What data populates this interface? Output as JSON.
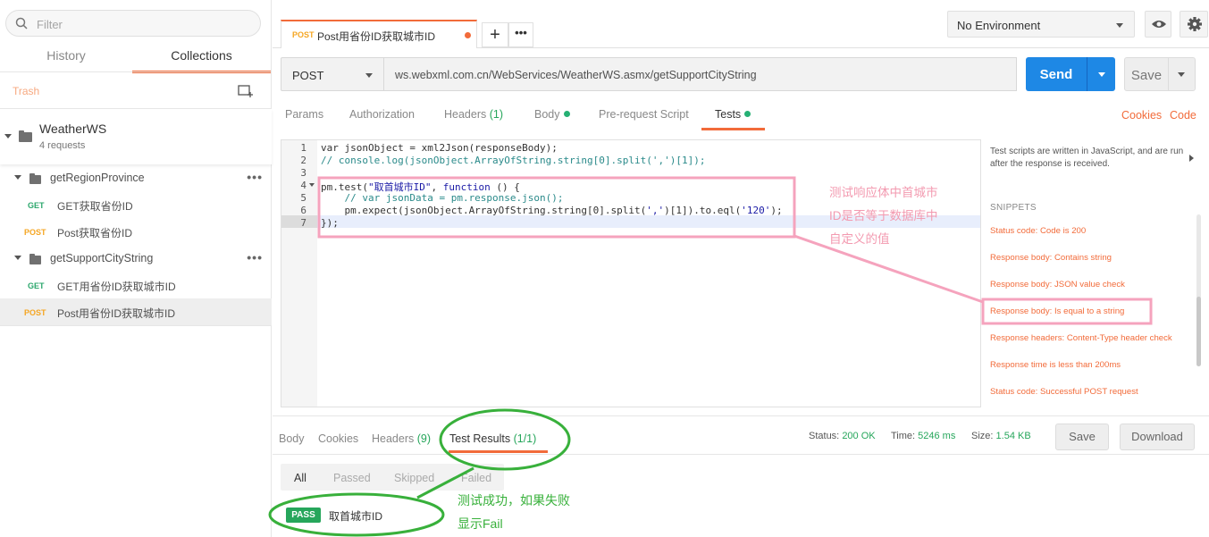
{
  "sidebar": {
    "filter_placeholder": "Filter",
    "tabs": [
      "History",
      "Collections"
    ],
    "trash_label": "Trash",
    "collection": {
      "name": "WeatherWS",
      "count": "4 requests"
    },
    "folders": [
      {
        "name": "getRegionProvince",
        "requests": [
          {
            "method": "GET",
            "name": "GET获取省份ID"
          },
          {
            "method": "POST",
            "name": "Post获取省份ID"
          }
        ]
      },
      {
        "name": "getSupportCityString",
        "requests": [
          {
            "method": "GET",
            "name": "GET用省份ID获取城市ID"
          },
          {
            "method": "POST",
            "name": "Post用省份ID获取城市ID"
          }
        ]
      }
    ]
  },
  "top_tab": {
    "method": "POST",
    "title": "Post用省份ID获取城市ID"
  },
  "environment": "No Environment",
  "request": {
    "method": "POST",
    "url": "ws.webxml.com.cn/WebServices/WeatherWS.asmx/getSupportCityString",
    "send_label": "Send",
    "save_label": "Save"
  },
  "request_tabs": {
    "params": "Params",
    "authorization": "Authorization",
    "headers": "Headers",
    "headers_count": "(1)",
    "body": "Body",
    "prerequest": "Pre-request Script",
    "tests": "Tests",
    "cookies": "Cookies",
    "code": "Code"
  },
  "editor": {
    "line_numbers": [
      "1",
      "2",
      "3",
      "4",
      "5",
      "6",
      "7"
    ],
    "lines": {
      "l1": "var jsonObject = xml2Json(responseBody);",
      "l2": "// console.log(jsonObject.ArrayOfString.string[0].split(',')[1]);",
      "l4a": "pm.test(",
      "l4b": "\"取首城市ID\"",
      "l4c": ", ",
      "l4d": "function",
      "l4e": " () {",
      "l5": "    // var jsonData = pm.response.json();",
      "l6a": "    pm.expect(jsonObject.ArrayOfString.string[0].split(",
      "l6b": "','",
      "l6c": ")[1]).to.eql(",
      "l6d": "'120'",
      "l6e": ");",
      "l7": "});"
    }
  },
  "snippets": {
    "description": "Test scripts are written in JavaScript, and are run after the response is received.",
    "title": "SNIPPETS",
    "items": [
      "Status code: Code is 200",
      "Response body: Contains string",
      "Response body: JSON value check",
      "Response body: Is equal to a string",
      "Response headers: Content-Type header check",
      "Response time is less than 200ms",
      "Status code: Successful POST request"
    ]
  },
  "response": {
    "tabs": {
      "body": "Body",
      "cookies": "Cookies",
      "headers": "Headers",
      "headers_count": "(9)",
      "test_results": "Test Results",
      "test_results_count": "(1/1)"
    },
    "status_label": "Status:",
    "status_value": "200 OK",
    "time_label": "Time:",
    "time_value": "5246 ms",
    "size_label": "Size:",
    "size_value": "1.54 KB",
    "save_label": "Save",
    "download_label": "Download",
    "filters": [
      "All",
      "Passed",
      "Skipped",
      "Failed"
    ],
    "result": {
      "badge": "PASS",
      "name": "取首城市ID"
    }
  },
  "annotations": {
    "pink": [
      "测试响应体中首城市",
      "ID是否等于数据库中",
      "自定义的值"
    ],
    "green": [
      "测试成功，如果失败",
      "显示Fail"
    ]
  },
  "colors": {
    "accent": "#f26b3a",
    "send": "#1e88e5",
    "pass": "#26a65b",
    "get": "#2ca76c",
    "post": "#f5a623",
    "annotation_pink": "#f39ab0",
    "annotation_green": "#37b03a"
  }
}
